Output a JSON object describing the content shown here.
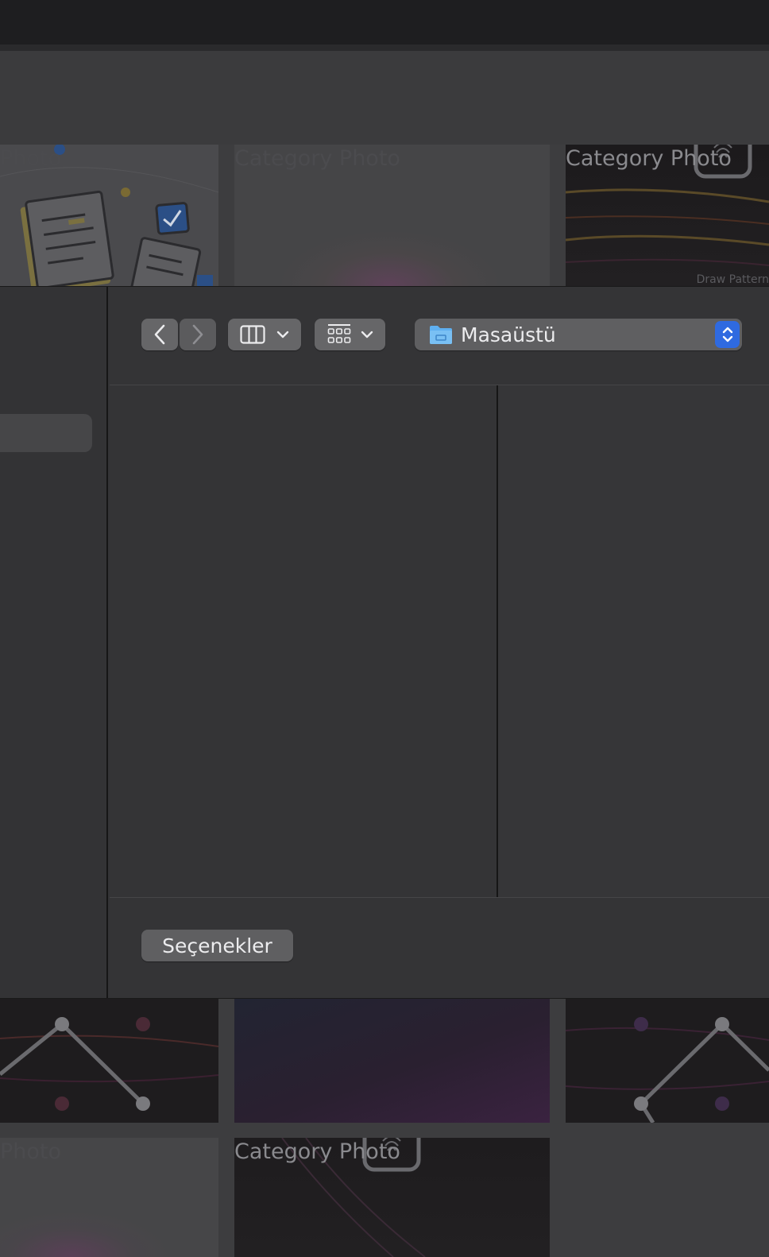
{
  "background": {
    "tiles": [
      {
        "label": "Photo",
        "style": "faded"
      },
      {
        "label": "Category Photo",
        "style": "faded"
      },
      {
        "label": "Category Photo",
        "style": "bright",
        "caption": "Draw Pattern"
      },
      {
        "label": "",
        "style": "pattern"
      },
      {
        "label": "",
        "style": "gradient"
      },
      {
        "label": "",
        "style": "pattern"
      },
      {
        "label": "Photo",
        "style": "faded"
      },
      {
        "label": "Category Photo",
        "style": "bright"
      }
    ]
  },
  "dialog": {
    "toolbar": {
      "back_icon": "chevron-left-icon",
      "forward_icon": "chevron-right-icon",
      "view_mode_icon": "columns-icon",
      "group_icon": "grid-icon",
      "location": "Masaüstü",
      "location_icon": "folder-icon"
    },
    "footer": {
      "options_label": "Seçenekler"
    }
  },
  "colors": {
    "accent": "#2f6ae0",
    "folder": "#5fb0f0",
    "dialog_bg": "#343436",
    "button_bg": "#666668"
  }
}
